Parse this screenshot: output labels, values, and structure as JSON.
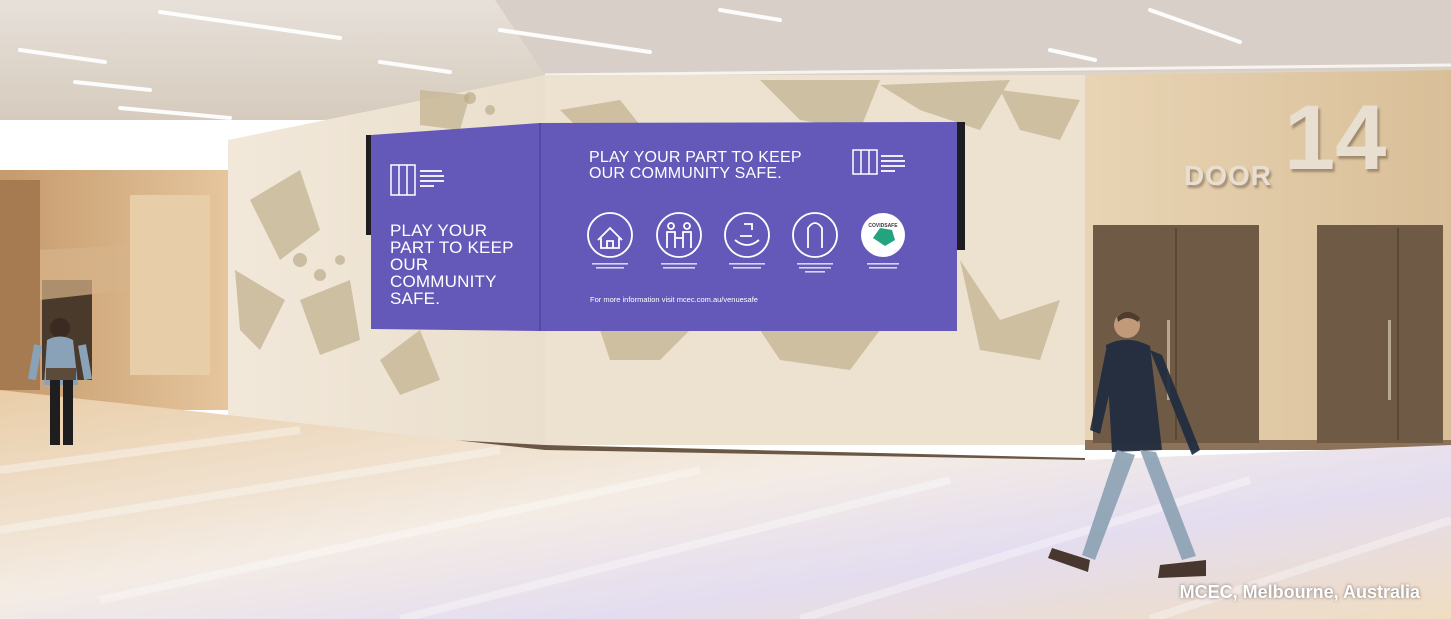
{
  "screen_left": {
    "headline": "PLAY YOUR PART TO KEEP OUR COMMUNITY SAFE.",
    "logo_text": "MELBOURNE CONVENTION EXHIBITION CENTRE"
  },
  "screen_right": {
    "headline": "PLAY YOUR PART TO KEEP OUR COMMUNITY SAFE.",
    "logo_text": "MELBOURNE CONVENTION EXHIBITION CENTRE",
    "icon_captions": [
      "Stay home if you're feeling unwell",
      "Adhere to physical distancing measures",
      "Wash or sanitise your hands often",
      "Follow appropriate cough and sneeze etiquette",
      "Download the COVIDSafe app"
    ],
    "covidsafe_badge": "COVIDSAFE",
    "footer": "For more information visit mcec.com.au/venuesafe"
  },
  "door_sign": {
    "word": "DOOR",
    "number": "14"
  },
  "caption": "MCEC, Melbourne, Australia",
  "colors": {
    "screen_purple": "#6459b8",
    "wall_cream": "#efe4d2",
    "wall_pattern": "#cdbfa6",
    "floor_light": "#f1e6da",
    "door_brown": "#6e5a45"
  }
}
